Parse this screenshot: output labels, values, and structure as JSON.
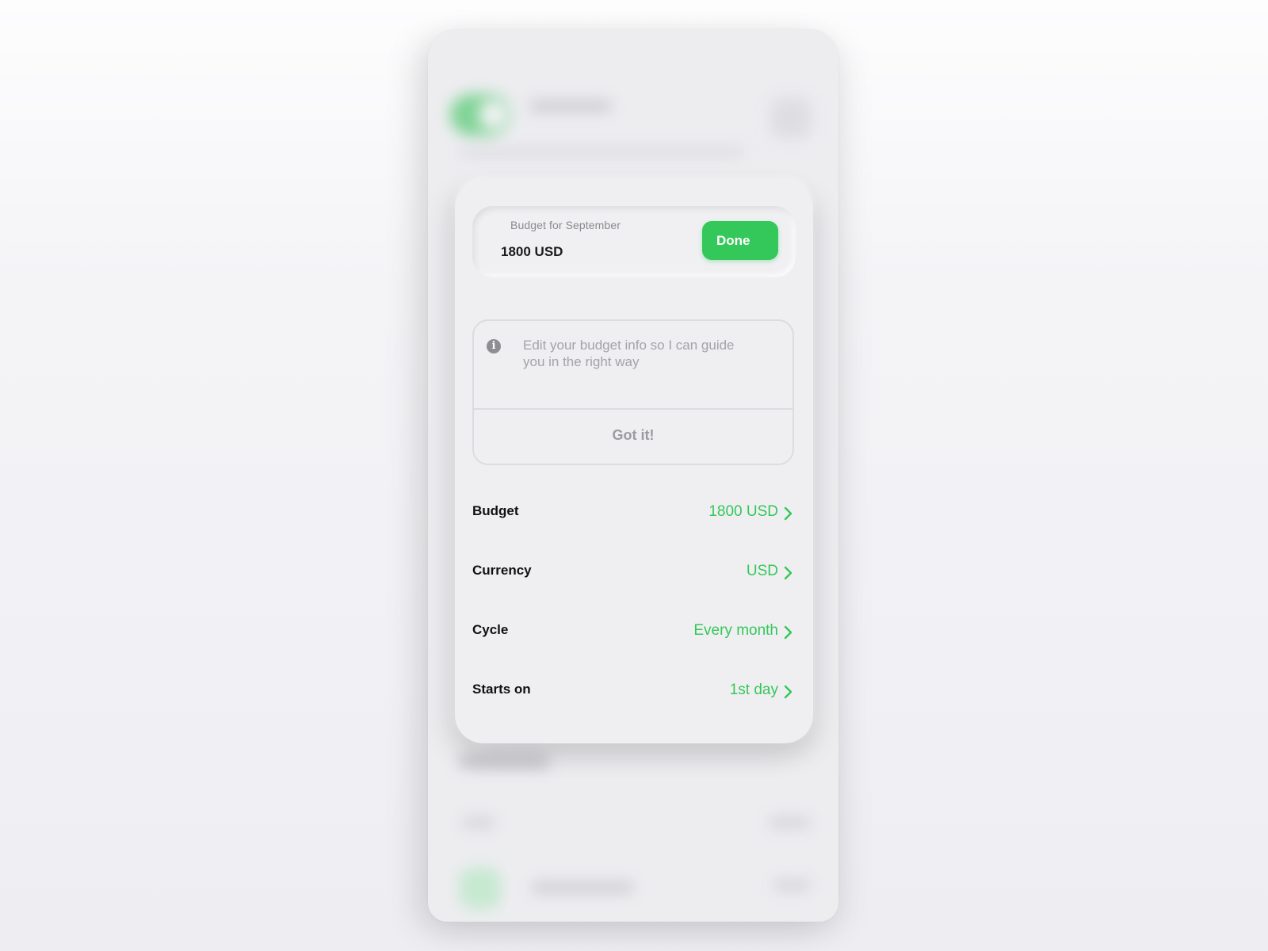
{
  "budget_field": {
    "label": "Budget for September",
    "value": "1800 USD",
    "done_label": "Done"
  },
  "info": {
    "icon": "info-icon",
    "message": "Edit your budget info so I can guide you in the right way",
    "dismiss_label": "Got it!"
  },
  "settings": [
    {
      "label": "Budget",
      "value": "1800 USD"
    },
    {
      "label": "Currency",
      "value": "USD"
    },
    {
      "label": "Cycle",
      "value": "Every month"
    },
    {
      "label": "Starts on",
      "value": "1st day"
    }
  ],
  "colors": {
    "accent": "#34c759",
    "card_background": "#efeff2",
    "muted_text": "#a3a3a8"
  }
}
